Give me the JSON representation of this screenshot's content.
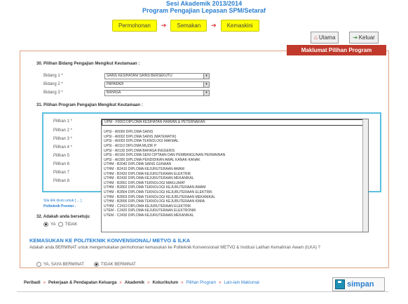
{
  "header": {
    "line1": "Sesi Akademik 2013/2014",
    "line2": "Program Pengajian Lepasan SPM/Setaraf"
  },
  "steps": [
    "Permohonan",
    "Semakan",
    "Kemaskini"
  ],
  "topbar": {
    "home": "Utama",
    "logout": "Keluar"
  },
  "panel_title": "Maklumat Pilihan Program",
  "q30": {
    "title": "30. Pilihan Bidang Pengajian Mengikut Keutamaan :",
    "rows": [
      {
        "label": "Bidang 1 *",
        "value": "SAINS KESIHATAN/ SAINS BERSEKUTU"
      },
      {
        "label": "Bidang 2 *",
        "value": "PAPARADI"
      },
      {
        "label": "Bidang 3 *",
        "value": "BAHASA"
      }
    ]
  },
  "q31": {
    "title": "31. Pilihan Program Pengajian Mengikut Keutamaan :",
    "labels": [
      "Pilihan 1 *",
      "Pilihan 2 *",
      "Pilihan 3 *",
      "Pilihan 4 *",
      "Pilihan 5",
      "Pilihan 6",
      "Pilihan 7",
      "Pilihan 8"
    ],
    "options": [
      "UPM - F0003 DIPLOMA KESIHATAN HAIWAN & PETERNAKAN",
      "",
      "UPSI - A0000 DIPLOMA SAINS",
      "UPSI - A0002 DIPLOMA SAINS (MATEMATIK)",
      "UPSI - A0003 DIPLOMA TEKNOLOGI MAKMAL",
      "UPSI - A0110 DIPLOMA MUZIK P",
      "UPSI - A0130 DIPLOMA BAHASA INGGERIS",
      "UPSI - A0160 DIPLOMA SENI CIPTAAN DAN PEMBANGUNAN PERMAINAN",
      "UPSI - A0300 DIPLOMA PENDIDIKAN AWAL KANAK-KANAK",
      "UTHM - B2040 DIPLOMA SAINS GUNAAN",
      "UTHM - B2410 DIPLOMA KEJURUTERAAN AWAM",
      "UTHM - B2420 DIPLOMA KEJURUTERAAN ELEKTRIK",
      "UTHM - B2430 DIPLOMA KEJURUTERAAN MEKANIKAL",
      "UTHM - B2801 DIPLOMA TEKNOLOGI MAKLUMAT",
      "UTHM - B2802 DIPLOMA TEKNOLOGI KEJURUTERAAN AWAM",
      "UTHM - B2804 DIPLOMA TEKNOLOGI KEJURUTERAAN ELEKTRIK",
      "UTHM - B2803 DIPLOMA TEKNOLOGI KEJURUTERAAN MEKANIKAL",
      "UTHM - B2806 DIPLOMA TEKNOLOGI KEJURUTERAAN KIMIA",
      "UTHM - C2410 DIPLOMA KEJURUTERAAN ELEKTRIK",
      "UTEM - C2420 DIPLOMA KEJURUTERAAN ELEKTRONIK",
      "UTEM - C2430 DIPLOMA KEJURUTERAAN MEKANIKAL"
    ],
    "note": "Sila klik disini untuk [ ... ]",
    "note2": "Politeknik Premier ."
  },
  "q32": {
    "title": "32. Adakah anda bersetuju",
    "yes": "YA",
    "no": "TIDAK"
  },
  "poli": {
    "title": "KEMASUKAN KE POLITEKNIK KONVENSIONAL/ METVO & ILKA",
    "text": "Adakah anda BERMINAT untuk mengemukakan permohonan kemasukan ke Politeknik Konvensional/ METVO & Institusi Latihan Kemahiran Awam (ILKA) ?",
    "yes": "YA, SAYA BERMINAT",
    "no": "TIDAK BERMINAT"
  },
  "footer": {
    "items": [
      "Peribadi",
      "Pekerjaan & Pendapatan Keluarga",
      "Akademik",
      "Kokurikulum",
      "Pilihan Program",
      "Lain-lain Maklumat"
    ],
    "current": "Pilihan Program",
    "save": "simpan"
  },
  "colors": {
    "accent": "#2a7fd0",
    "maklumat": "#c0392b",
    "step": "#ffff00"
  }
}
